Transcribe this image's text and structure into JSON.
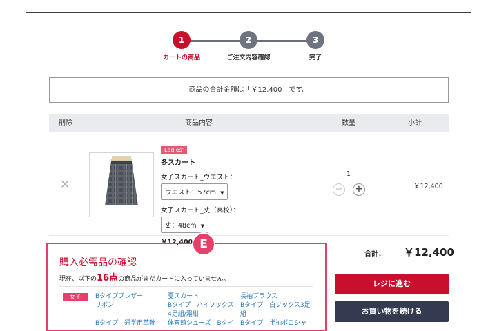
{
  "steps": [
    {
      "num": "1",
      "label": "カートの商品"
    },
    {
      "num": "2",
      "label": "ご注文内容確認"
    },
    {
      "num": "3",
      "label": "完了"
    }
  ],
  "total_notice": "商品の合計金額は「￥12,400」です。",
  "table": {
    "headers": [
      "削除",
      "商品内容",
      "数量",
      "小計"
    ],
    "item": {
      "remove_icon": "close-icon",
      "badge": "Ladies'",
      "name": "冬スカート",
      "option1_label": "女子スカート_ウエスト：",
      "option1_value": "ウエスト：57cm",
      "option2_label": "女子スカート_丈（高校）：",
      "option2_value": "丈：48cm",
      "price": "￥12,400",
      "quantity": "1",
      "minus": "−",
      "plus": "+",
      "subtotal": "￥12,400"
    }
  },
  "required": {
    "marker": "E",
    "title": "購入必需品の確認",
    "msg_prefix": "現在、以下の",
    "msg_count": "16点",
    "msg_suffix": "の商品がまだカートに入っていません。",
    "gender_tag": "女子",
    "links": [
      "Bタイプブレザー",
      "リボン",
      "夏スカート",
      "Bタイプ　ハイソックス",
      "4足組/濃紺",
      "長袖ブラウス",
      "Bタイプ　白ソックス3足",
      "組",
      "Bタイプ　通学用革靴",
      "体育館シューズ　Bタイ",
      "Bタイプ　半袖ポロシャ"
    ]
  },
  "summary": {
    "label": "合計：",
    "value": "￥12,400"
  },
  "buttons": {
    "checkout": "レジに進む",
    "continue": "お買い物を続ける"
  },
  "colors": {
    "accent": "#c8102e",
    "highlight": "#e6406a",
    "navy": "#343b51",
    "link": "#2a78b8"
  }
}
